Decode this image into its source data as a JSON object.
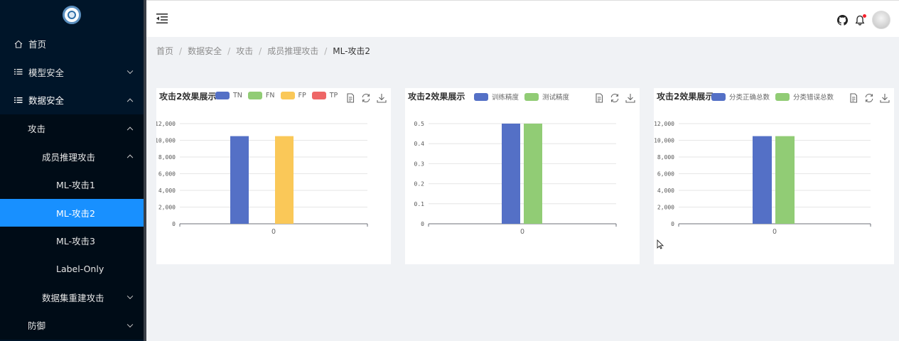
{
  "sidebar": {
    "items": [
      {
        "label": "首页"
      },
      {
        "label": "模型安全"
      },
      {
        "label": "数据安全"
      },
      {
        "label": "攻击"
      },
      {
        "label": "成员推理攻击"
      },
      {
        "label": "ML-攻击1"
      },
      {
        "label": "ML-攻击2"
      },
      {
        "label": "ML-攻击3"
      },
      {
        "label": "Label-Only"
      },
      {
        "label": "数据集重建攻击"
      },
      {
        "label": "防御"
      }
    ]
  },
  "header": {
    "icons": [
      "menu-fold-icon",
      "github-icon",
      "bell-icon",
      "avatar"
    ],
    "notification_color": "#f5222d"
  },
  "breadcrumb": {
    "items": [
      "首页",
      "数据安全",
      "攻击",
      "成员推理攻击"
    ],
    "current": "ML-攻击2",
    "separator": "/"
  },
  "toolbox": [
    "data-view-icon",
    "restore-icon",
    "download-icon"
  ],
  "chart_data": [
    {
      "type": "bar",
      "title": "攻击2效果展示",
      "categories": [
        "0"
      ],
      "ylim": [
        0,
        12000
      ],
      "yticks": [
        "0",
        "2,000",
        "4,000",
        "6,000",
        "8,000",
        "10,000",
        "12,000"
      ],
      "yvalues": [
        0,
        2000,
        4000,
        6000,
        8000,
        10000,
        12000
      ],
      "legend": [
        {
          "name": "TN",
          "color": "#5470c6"
        },
        {
          "name": "FN",
          "color": "#91cc75"
        },
        {
          "name": "FP",
          "color": "#fac858"
        },
        {
          "name": "TP",
          "color": "#ee6666"
        }
      ],
      "series": [
        {
          "name": "TN",
          "values": [
            10500
          ]
        },
        {
          "name": "FN",
          "values": [
            0
          ]
        },
        {
          "name": "FP",
          "values": [
            10500
          ]
        },
        {
          "name": "TP",
          "values": [
            0
          ]
        }
      ]
    },
    {
      "type": "bar",
      "title": "攻击2效果展示",
      "categories": [
        "0"
      ],
      "ylim": [
        0,
        0.5
      ],
      "yticks": [
        "0",
        "0.1",
        "0.2",
        "0.3",
        "0.4",
        "0.5"
      ],
      "yvalues": [
        0,
        0.1,
        0.2,
        0.3,
        0.4,
        0.5
      ],
      "legend": [
        {
          "name": "训练精度",
          "color": "#5470c6"
        },
        {
          "name": "测试精度",
          "color": "#91cc75"
        }
      ],
      "series": [
        {
          "name": "训练精度",
          "values": [
            0.5
          ]
        },
        {
          "name": "测试精度",
          "values": [
            0.5
          ]
        }
      ]
    },
    {
      "type": "bar",
      "title": "攻击2效果展示",
      "categories": [
        "0"
      ],
      "ylim": [
        0,
        12000
      ],
      "yticks": [
        "0",
        "2,000",
        "4,000",
        "6,000",
        "8,000",
        "10,000",
        "12,000"
      ],
      "yvalues": [
        0,
        2000,
        4000,
        6000,
        8000,
        10000,
        12000
      ],
      "legend": [
        {
          "name": "分类正确总数",
          "color": "#5470c6"
        },
        {
          "name": "分类错误总数",
          "color": "#91cc75"
        }
      ],
      "series": [
        {
          "name": "分类正确总数",
          "values": [
            10500
          ]
        },
        {
          "name": "分类错误总数",
          "values": [
            10500
          ]
        }
      ]
    }
  ]
}
